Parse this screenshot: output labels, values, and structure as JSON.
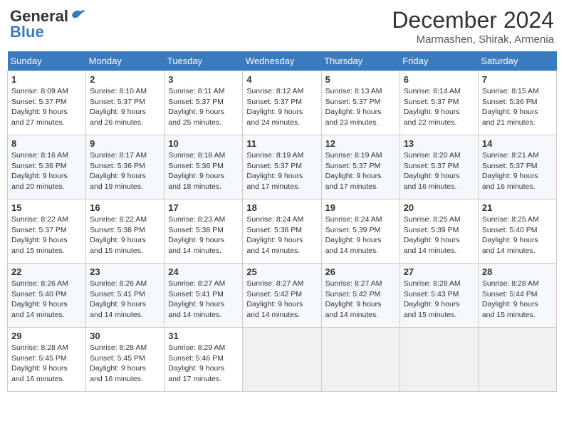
{
  "header": {
    "logo_general": "General",
    "logo_blue": "Blue",
    "month_year": "December 2024",
    "location": "Marmashen, Shirak, Armenia"
  },
  "days_of_week": [
    "Sunday",
    "Monday",
    "Tuesday",
    "Wednesday",
    "Thursday",
    "Friday",
    "Saturday"
  ],
  "weeks": [
    [
      {
        "day": 1,
        "sunrise": "8:09 AM",
        "sunset": "5:37 PM",
        "daylight": "9 hours and 27 minutes."
      },
      {
        "day": 2,
        "sunrise": "8:10 AM",
        "sunset": "5:37 PM",
        "daylight": "9 hours and 26 minutes."
      },
      {
        "day": 3,
        "sunrise": "8:11 AM",
        "sunset": "5:37 PM",
        "daylight": "9 hours and 25 minutes."
      },
      {
        "day": 4,
        "sunrise": "8:12 AM",
        "sunset": "5:37 PM",
        "daylight": "9 hours and 24 minutes."
      },
      {
        "day": 5,
        "sunrise": "8:13 AM",
        "sunset": "5:37 PM",
        "daylight": "9 hours and 23 minutes."
      },
      {
        "day": 6,
        "sunrise": "8:14 AM",
        "sunset": "5:37 PM",
        "daylight": "9 hours and 22 minutes."
      },
      {
        "day": 7,
        "sunrise": "8:15 AM",
        "sunset": "5:36 PM",
        "daylight": "9 hours and 21 minutes."
      }
    ],
    [
      {
        "day": 8,
        "sunrise": "8:16 AM",
        "sunset": "5:36 PM",
        "daylight": "9 hours and 20 minutes."
      },
      {
        "day": 9,
        "sunrise": "8:17 AM",
        "sunset": "5:36 PM",
        "daylight": "9 hours and 19 minutes."
      },
      {
        "day": 10,
        "sunrise": "8:18 AM",
        "sunset": "5:36 PM",
        "daylight": "9 hours and 18 minutes."
      },
      {
        "day": 11,
        "sunrise": "8:19 AM",
        "sunset": "5:37 PM",
        "daylight": "9 hours and 17 minutes."
      },
      {
        "day": 12,
        "sunrise": "8:19 AM",
        "sunset": "5:37 PM",
        "daylight": "9 hours and 17 minutes."
      },
      {
        "day": 13,
        "sunrise": "8:20 AM",
        "sunset": "5:37 PM",
        "daylight": "9 hours and 16 minutes."
      },
      {
        "day": 14,
        "sunrise": "8:21 AM",
        "sunset": "5:37 PM",
        "daylight": "9 hours and 16 minutes."
      }
    ],
    [
      {
        "day": 15,
        "sunrise": "8:22 AM",
        "sunset": "5:37 PM",
        "daylight": "9 hours and 15 minutes."
      },
      {
        "day": 16,
        "sunrise": "8:22 AM",
        "sunset": "5:38 PM",
        "daylight": "9 hours and 15 minutes."
      },
      {
        "day": 17,
        "sunrise": "8:23 AM",
        "sunset": "5:38 PM",
        "daylight": "9 hours and 14 minutes."
      },
      {
        "day": 18,
        "sunrise": "8:24 AM",
        "sunset": "5:38 PM",
        "daylight": "9 hours and 14 minutes."
      },
      {
        "day": 19,
        "sunrise": "8:24 AM",
        "sunset": "5:39 PM",
        "daylight": "9 hours and 14 minutes."
      },
      {
        "day": 20,
        "sunrise": "8:25 AM",
        "sunset": "5:39 PM",
        "daylight": "9 hours and 14 minutes."
      },
      {
        "day": 21,
        "sunrise": "8:25 AM",
        "sunset": "5:40 PM",
        "daylight": "9 hours and 14 minutes."
      }
    ],
    [
      {
        "day": 22,
        "sunrise": "8:26 AM",
        "sunset": "5:40 PM",
        "daylight": "9 hours and 14 minutes."
      },
      {
        "day": 23,
        "sunrise": "8:26 AM",
        "sunset": "5:41 PM",
        "daylight": "9 hours and 14 minutes."
      },
      {
        "day": 24,
        "sunrise": "8:27 AM",
        "sunset": "5:41 PM",
        "daylight": "9 hours and 14 minutes."
      },
      {
        "day": 25,
        "sunrise": "8:27 AM",
        "sunset": "5:42 PM",
        "daylight": "9 hours and 14 minutes."
      },
      {
        "day": 26,
        "sunrise": "8:27 AM",
        "sunset": "5:42 PM",
        "daylight": "9 hours and 14 minutes."
      },
      {
        "day": 27,
        "sunrise": "8:28 AM",
        "sunset": "5:43 PM",
        "daylight": "9 hours and 15 minutes."
      },
      {
        "day": 28,
        "sunrise": "8:28 AM",
        "sunset": "5:44 PM",
        "daylight": "9 hours and 15 minutes."
      }
    ],
    [
      {
        "day": 29,
        "sunrise": "8:28 AM",
        "sunset": "5:45 PM",
        "daylight": "9 hours and 16 minutes."
      },
      {
        "day": 30,
        "sunrise": "8:28 AM",
        "sunset": "5:45 PM",
        "daylight": "9 hours and 16 minutes."
      },
      {
        "day": 31,
        "sunrise": "8:29 AM",
        "sunset": "5:46 PM",
        "daylight": "9 hours and 17 minutes."
      },
      null,
      null,
      null,
      null
    ]
  ],
  "labels": {
    "sunrise": "Sunrise:",
    "sunset": "Sunset:",
    "daylight": "Daylight:"
  }
}
